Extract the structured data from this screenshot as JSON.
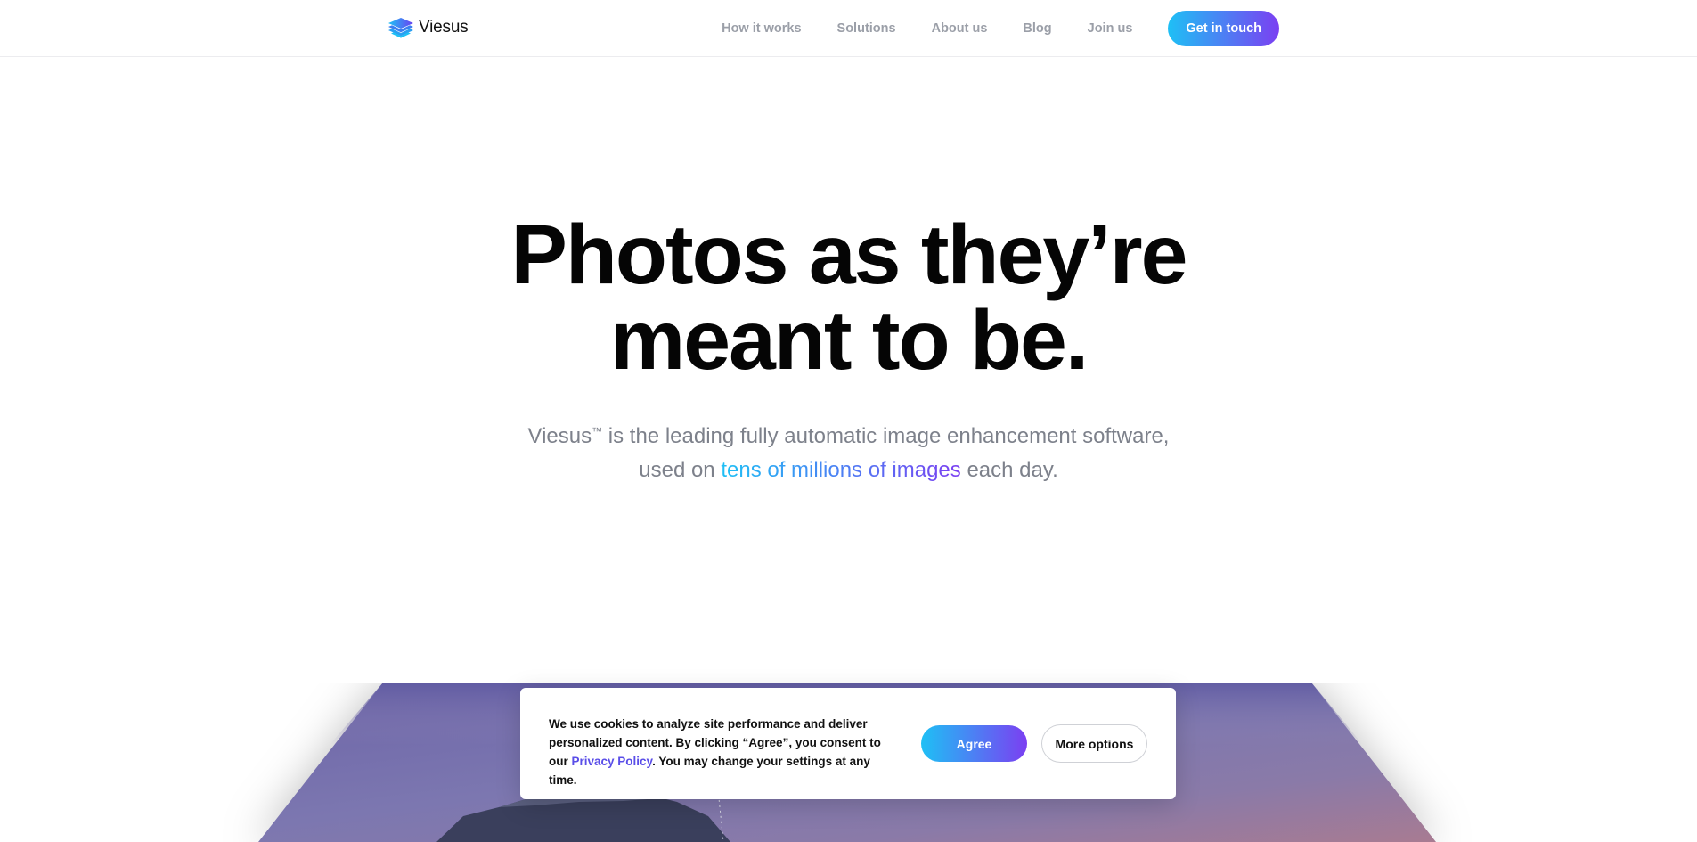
{
  "header": {
    "brand": "Viesus",
    "nav": [
      "How it works",
      "Solutions",
      "About us",
      "Blog",
      "Join us"
    ],
    "cta_label": "Get in touch"
  },
  "hero": {
    "title_line1": "Photos as they’re",
    "title_line2": "meant to be.",
    "subtitle_brand": "Viesus",
    "subtitle_tm": "™",
    "subtitle_line1_rest": " is the leading fully automatic image enhancement software,",
    "subtitle_line2_start": "used on ",
    "subtitle_highlight": "tens of millions of images",
    "subtitle_line2_end": " each day."
  },
  "cookie_banner": {
    "text_before_link": "We use cookies to analyze site performance and deliver personalized content. By clicking “Agree”, you consent to our ",
    "link_label": "Privacy Policy",
    "text_after_link": ". You may change your settings at any time.",
    "agree_label": "Agree",
    "more_label": "More options"
  },
  "colors": {
    "accent_start": "#1ec0f5",
    "accent_end": "#7b3ff2",
    "nav_text": "#9b9fa8",
    "subtitle_text": "#7d818b"
  },
  "icons": {
    "logo": "stacked-layers-logo-icon"
  }
}
